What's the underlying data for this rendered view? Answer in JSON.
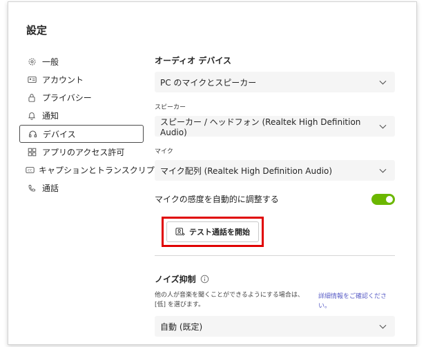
{
  "settings": {
    "title": "設定"
  },
  "nav": {
    "items": [
      {
        "label": "一般",
        "icon": "gear-icon"
      },
      {
        "label": "アカウント",
        "icon": "id-card-icon"
      },
      {
        "label": "プライバシー",
        "icon": "lock-icon"
      },
      {
        "label": "通知",
        "icon": "bell-icon"
      },
      {
        "label": "デバイス",
        "icon": "headset-icon",
        "active": true
      },
      {
        "label": "アプリのアクセス許可",
        "icon": "apps-grid-icon"
      },
      {
        "label": "キャプションとトランスクリプト",
        "icon": "closed-caption-icon"
      },
      {
        "label": "通話",
        "icon": "phone-icon"
      }
    ]
  },
  "audio": {
    "heading": "オーディオ デバイス",
    "device_value": "PC のマイクとスピーカー",
    "speaker_label": "スピーカー",
    "speaker_value": "スピーカー / ヘッドフォン (Realtek High Definition Audio)",
    "mic_label": "マイク",
    "mic_value": "マイク配列 (Realtek High Definition Audio)",
    "auto_adjust_label": "マイクの感度を自動的に調整する",
    "auto_adjust_on": true,
    "test_call_label": "テスト通話を開始"
  },
  "noise": {
    "heading": "ノイズ抑制",
    "description": "他の人が音楽を聞くことができるようにする場合は、[低] を選びます。",
    "link": "詳細情報をご確認ください。",
    "value": "自動 (既定)"
  },
  "colors": {
    "accent_link": "#5b5fc7",
    "toggle_on": "#6bb700",
    "highlight_box": "#e00000"
  }
}
